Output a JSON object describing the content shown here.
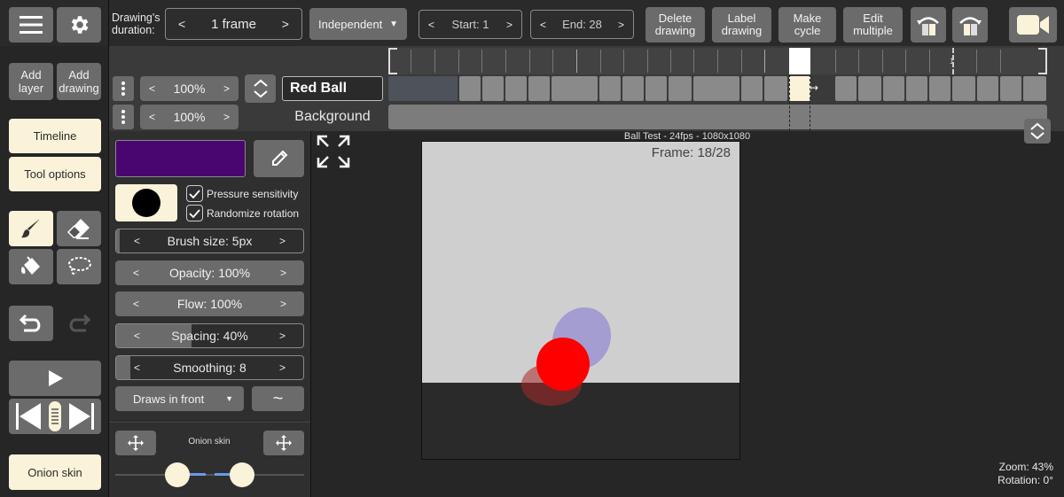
{
  "toolbar": {
    "drawing_duration_label": "Drawing's duration:",
    "duration_value": "1 frame",
    "mode_value": "Independent",
    "start_label": "Start: 1",
    "end_label": "End: 28",
    "delete_drawing": "Delete drawing",
    "label_drawing": "Label drawing",
    "make_cycle": "Make cycle",
    "edit_multiple": "Edit multiple"
  },
  "sidebar": {
    "add_layer": "Add layer",
    "add_drawing": "Add drawing",
    "timeline": "Timeline",
    "tool_options": "Tool options",
    "onion_skin": "Onion skin"
  },
  "layers": [
    {
      "opacity": "100%",
      "name": "Red Ball"
    },
    {
      "opacity": "100%",
      "name": "Background"
    }
  ],
  "tool_options": {
    "pressure_sensitivity": "Pressure sensitivity",
    "randomize_rotation": "Randomize rotation",
    "brush_size": "Brush size:  5px",
    "opacity": "Opacity:  100%",
    "flow": "Flow:  100%",
    "spacing": "Spacing:  40%",
    "smoothing": "Smoothing:  8",
    "draws_in_front": "Draws in front",
    "onion_skin_label": "Onion skin",
    "color": "#4a0670"
  },
  "canvas": {
    "info": "Ball Test - 24fps - 1080x1080",
    "frame": "Frame: 18/28",
    "zoom": "Zoom: 43%",
    "rotation": "Rotation: 0°"
  },
  "timeline": {
    "current_frame_marker": "1"
  }
}
